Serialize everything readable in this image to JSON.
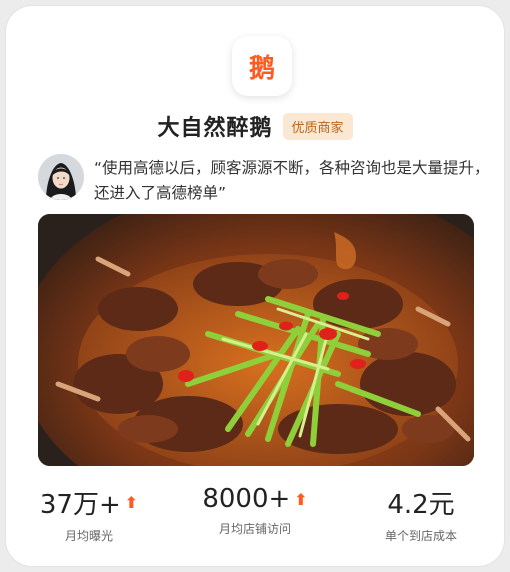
{
  "logo": {
    "char": "鹅",
    "color": "#ff5a1f"
  },
  "shop": {
    "name": "大自然醉鹅",
    "badge": "优质商家"
  },
  "testimonial": {
    "text": "“使用高德以后，顾客源源不断，各种咨询也是大量提升，还进入了高德榜单”"
  },
  "stats": [
    {
      "value": "37万+",
      "label": "月均曝光",
      "trend_icon": "up-arrow-icon"
    },
    {
      "value": "8000+",
      "label": "月均店铺访问",
      "trend_icon": "up-arrow-icon"
    },
    {
      "value": "4.2元",
      "label": "单个到店成本"
    }
  ],
  "colors": {
    "accent": "#ff5a1f",
    "badge_bg": "#fbe8d2",
    "badge_text": "#b8651b"
  }
}
